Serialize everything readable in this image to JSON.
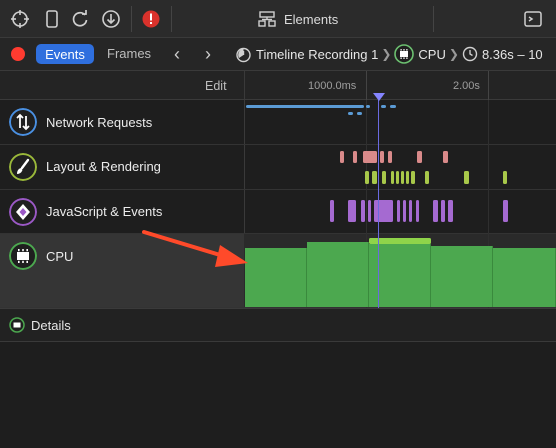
{
  "toolbar": {
    "icons": [
      "crosshair-icon",
      "device-icon",
      "reload-icon",
      "download-icon",
      "error-icon"
    ],
    "elements_tab_label": "Elements",
    "right_tab_icon": "console-icon"
  },
  "timeline_bar": {
    "record_icon": "record-icon",
    "events_label": "Events",
    "frames_label": "Frames",
    "breadcrumbs": [
      {
        "icon": "stopwatch-icon",
        "label": "Timeline Recording 1"
      },
      {
        "icon": "cpu-icon",
        "label": "CPU"
      },
      {
        "icon": "clock-icon",
        "label": "8.36s – 10"
      }
    ]
  },
  "ruler": {
    "edit_label": "Edit",
    "ticks": [
      "1000.0ms",
      "2.00s"
    ]
  },
  "rows": [
    {
      "label": "Network Requests",
      "icon": "network-arrows-icon",
      "color": "#4a90e2"
    },
    {
      "label": "Layout & Rendering",
      "icon": "paintbrush-icon",
      "color": "#9ab83a"
    },
    {
      "label": "JavaScript & Events",
      "icon": "script-icon",
      "color": "#9b59c6"
    },
    {
      "label": "CPU",
      "icon": "cpu-chip-icon",
      "color": "#4ca84f"
    }
  ],
  "details": {
    "label": "Details",
    "icon": "cpu-chip-icon"
  },
  "annotation": {
    "icon": "red-arrow-icon",
    "color": "#ff4a2a"
  },
  "colors": {
    "network": "#5b9bd5",
    "layout_pink": "#d98a8a",
    "layout_green": "#a8c84a",
    "javascript": "#a56ad1",
    "cpu": "#4ca84f",
    "playhead": "#6a6ae0",
    "accent": "#2f6fde"
  }
}
